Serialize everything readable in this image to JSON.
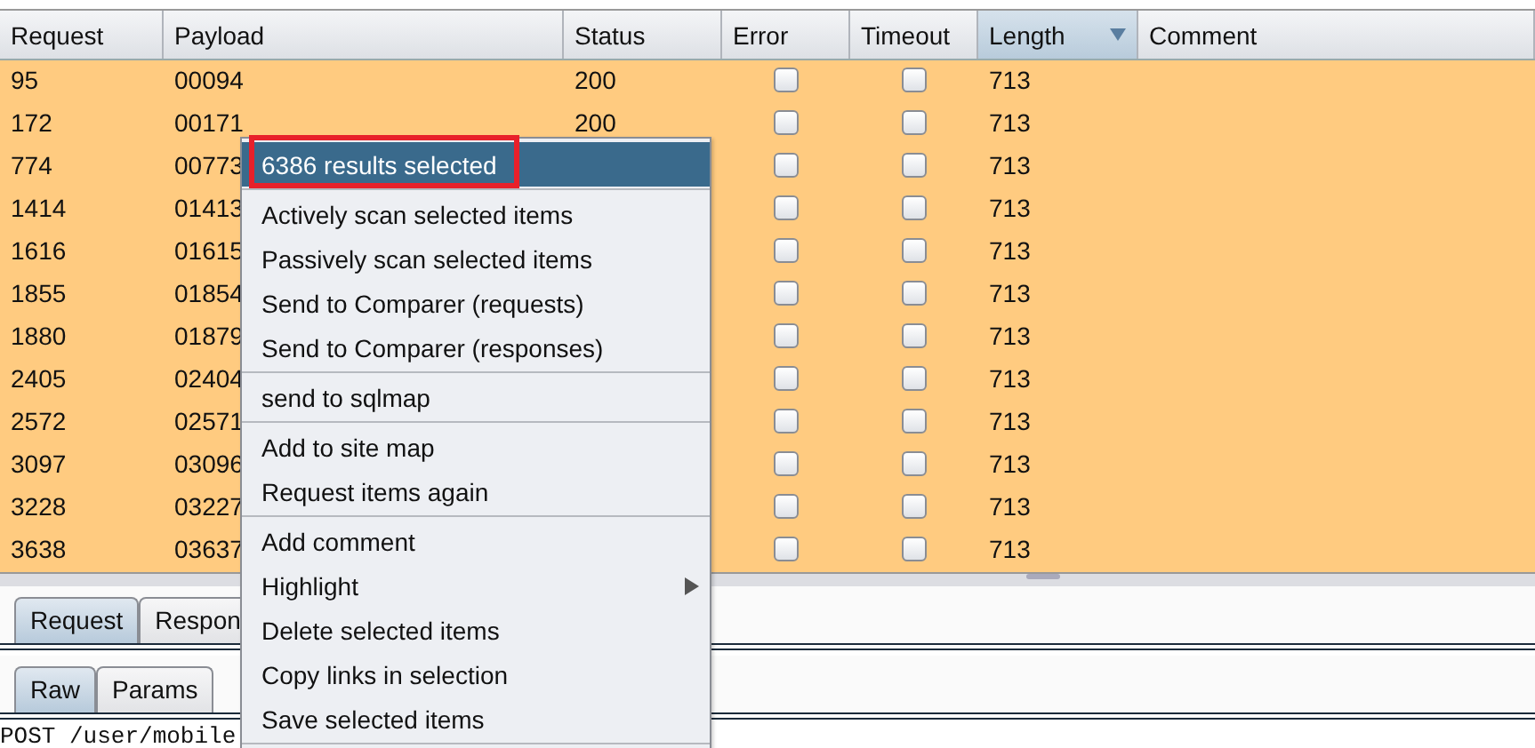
{
  "table": {
    "columns": [
      {
        "label": "Request",
        "sorted": false
      },
      {
        "label": "Payload",
        "sorted": false
      },
      {
        "label": "Status",
        "sorted": false
      },
      {
        "label": "Error",
        "sorted": false
      },
      {
        "label": "Timeout",
        "sorted": false
      },
      {
        "label": "Length",
        "sorted": true
      },
      {
        "label": "Comment",
        "sorted": false
      }
    ],
    "rows": [
      {
        "request": "95",
        "payload": "00094",
        "status": "200",
        "error": false,
        "timeout": false,
        "length": "713"
      },
      {
        "request": "172",
        "payload": "00171",
        "status": "200",
        "error": false,
        "timeout": false,
        "length": "713"
      },
      {
        "request": "774",
        "payload": "00773",
        "error": false,
        "timeout": false,
        "length": "713"
      },
      {
        "request": "1414",
        "payload": "01413",
        "error": false,
        "timeout": false,
        "length": "713"
      },
      {
        "request": "1616",
        "payload": "01615",
        "error": false,
        "timeout": false,
        "length": "713"
      },
      {
        "request": "1855",
        "payload": "01854",
        "error": false,
        "timeout": false,
        "length": "713"
      },
      {
        "request": "1880",
        "payload": "01879",
        "error": false,
        "timeout": false,
        "length": "713"
      },
      {
        "request": "2405",
        "payload": "02404",
        "error": false,
        "timeout": false,
        "length": "713"
      },
      {
        "request": "2572",
        "payload": "02571",
        "error": false,
        "timeout": false,
        "length": "713"
      },
      {
        "request": "3097",
        "payload": "03096",
        "error": false,
        "timeout": false,
        "length": "713"
      },
      {
        "request": "3228",
        "payload": "03227",
        "error": false,
        "timeout": false,
        "length": "713"
      },
      {
        "request": "3638",
        "payload": "03637",
        "error": false,
        "timeout": false,
        "length": "713"
      }
    ]
  },
  "tabs": [
    {
      "label": "Request",
      "selected": true
    },
    {
      "label": "Respon",
      "selected": false
    }
  ],
  "subtabs": [
    {
      "label": "Raw",
      "selected": true
    },
    {
      "label": "Params",
      "selected": false
    }
  ],
  "editor_lines": [
    "POST /user/mobile"
  ],
  "context_menu": {
    "groups": [
      [
        {
          "label": "6386 results selected",
          "selected": true,
          "annotated": true
        }
      ],
      [
        {
          "label": "Actively scan selected items",
          "selected": false
        },
        {
          "label": "Passively scan selected items",
          "selected": false
        },
        {
          "label": "Send to Comparer (requests)",
          "selected": false
        },
        {
          "label": "Send to Comparer (responses)",
          "selected": false
        }
      ],
      [
        {
          "label": "send to sqlmap",
          "selected": false
        }
      ],
      [
        {
          "label": "Add to site map",
          "selected": false
        },
        {
          "label": "Request items again",
          "selected": false
        }
      ],
      [
        {
          "label": "Add comment",
          "selected": false
        },
        {
          "label": "Highlight",
          "selected": false,
          "submenu": true
        },
        {
          "label": "Delete selected items",
          "selected": false
        },
        {
          "label": "Copy links in selection",
          "selected": false
        },
        {
          "label": "Save selected items",
          "selected": false
        }
      ]
    ]
  }
}
